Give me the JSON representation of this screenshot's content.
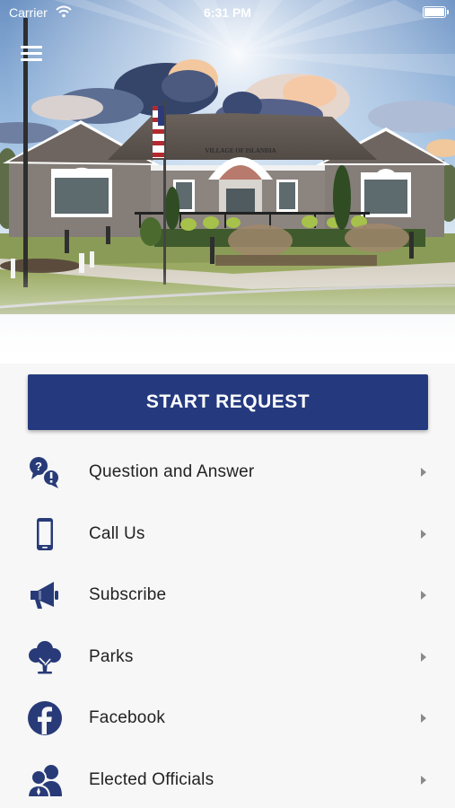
{
  "status_bar": {
    "carrier": "Carrier",
    "time": "6:31 PM",
    "wifi_icon": "wifi-icon",
    "battery_icon": "battery-icon"
  },
  "header": {
    "menu_icon": "hamburger-menu-icon",
    "building_sign": "VILLAGE OF ISLANDIA"
  },
  "start_request": {
    "label": "START REQUEST"
  },
  "menu": {
    "items": [
      {
        "label": "Question and Answer",
        "icon": "question-answer-icon"
      },
      {
        "label": "Call Us",
        "icon": "phone-icon"
      },
      {
        "label": "Subscribe",
        "icon": "megaphone-icon"
      },
      {
        "label": "Parks",
        "icon": "tree-icon"
      },
      {
        "label": "Facebook",
        "icon": "facebook-icon"
      },
      {
        "label": "Elected Officials",
        "icon": "officials-icon"
      }
    ]
  },
  "colors": {
    "brand_navy": "#253a7e",
    "icon_navy": "#283b78",
    "chevron": "#8a8a8a",
    "text": "#222222",
    "background": "#f7f7f7"
  }
}
